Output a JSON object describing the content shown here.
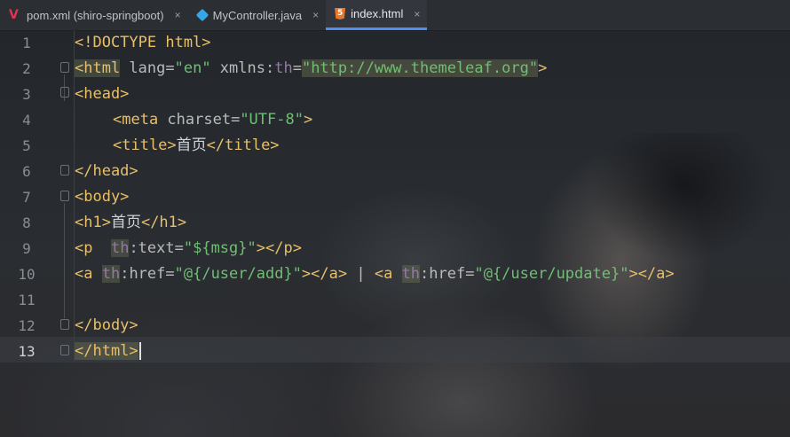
{
  "tabs": [
    {
      "icon": "maven-icon",
      "label": "pom.xml (shiro-springboot)",
      "active": false
    },
    {
      "icon": "java-class-icon",
      "label": "MyController.java",
      "active": false
    },
    {
      "icon": "html5-icon",
      "label": "index.html",
      "active": true
    }
  ],
  "close_glyph": "×",
  "editor": {
    "current_line": 13,
    "line_numbers": [
      "1",
      "2",
      "3",
      "4",
      "5",
      "6",
      "7",
      "8",
      "9",
      "10",
      "11",
      "12",
      "13"
    ],
    "lines": {
      "l1": "<!DOCTYPE html>",
      "l2_tag": "<html",
      "l2_attr1": " lang=",
      "l2_val1": "\"en\"",
      "l2_ns": " xmlns:",
      "l2_th": "th",
      "l2_eq": "=",
      "l2_val2": "\"http://www.themeleaf.org\"",
      "l2_end": ">",
      "l3": "<head>",
      "l4_open": "<meta",
      "l4_attr": " charset=",
      "l4_val": "\"UTF-8\"",
      "l4_close": ">",
      "l5_open": "<title>",
      "l5_text": "首页",
      "l5_close": "</title>",
      "l6": "</head>",
      "l7": "<body>",
      "l8_open": "<h1>",
      "l8_text": "首页",
      "l8_close": "</h1>",
      "l9_open": "<p  ",
      "l9_th": "th",
      "l9_attr": ":text=",
      "l9_val": "\"${msg}\"",
      "l9_close": "></p>",
      "l10_a1": "<a ",
      "l10_th1": "th",
      "l10_attr1": ":href=",
      "l10_val1": "\"@{/user/add}\"",
      "l10_close1": "></a>",
      "l10_pipe": " | ",
      "l10_a2": "<a ",
      "l10_th2": "th",
      "l10_attr2": ":href=",
      "l10_val2": "\"@{/user/update}\"",
      "l10_close2": "></a>",
      "l12": "</body>",
      "l13": "</html>"
    }
  }
}
